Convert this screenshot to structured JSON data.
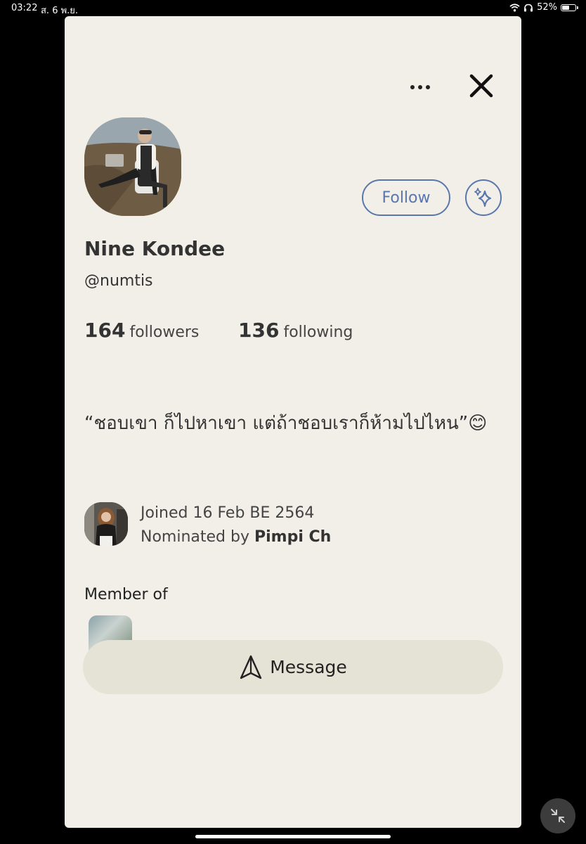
{
  "status_bar": {
    "time": "03:22",
    "date": "ส. 6 พ.ย.",
    "battery": "52%",
    "battery_level": 0.52
  },
  "profile": {
    "name": "Nine Kondee",
    "handle": "@numtis",
    "follow_label": "Follow",
    "followers": {
      "count": "164",
      "label": "followers"
    },
    "following": {
      "count": "136",
      "label": "following"
    },
    "bio": "“ชอบเขา ก็ไปหาเขา แต่ถ้าชอบเราก็ห้ามไปไหน”😊",
    "joined_text": "Joined 16 Feb BE 2564",
    "nominated_prefix": "Nominated by ",
    "nominated_by": "Pimpi Ch",
    "member_of_label": "Member of",
    "message_label": "Message"
  },
  "icons": {
    "more": "more-horizontal-icon",
    "close": "close-icon",
    "sparkle": "sparkle-icon",
    "send": "send-icon",
    "collapse": "collapse-icon"
  },
  "colors": {
    "card_background": "#f1efe7",
    "accent": "#5a77ad",
    "message_button": "#e5e2d6"
  }
}
